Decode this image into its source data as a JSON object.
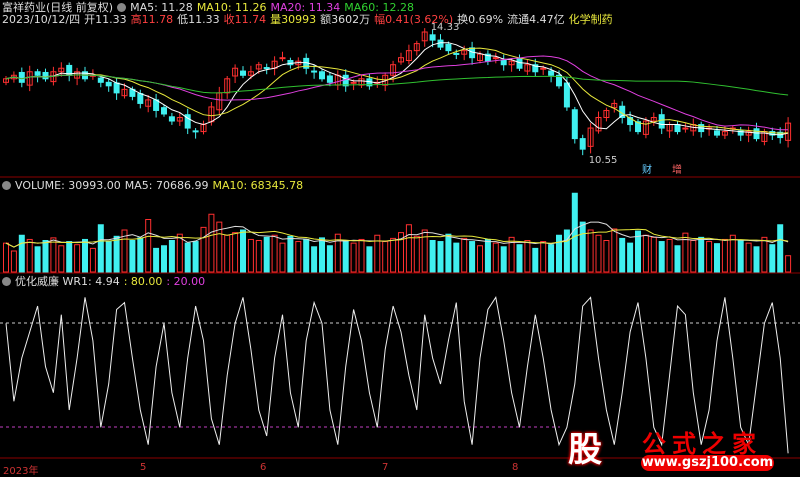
{
  "header": {
    "name": "富祥药业(日线 前复权)",
    "ma5": "MA5: 11.28",
    "ma10": "MA10: 11.26",
    "ma20": "MA20: 11.34",
    "ma60": "MA60: 12.28",
    "date": "2023/10/12/四",
    "open": "开11.33",
    "high": "高11.78",
    "low": "低11.33",
    "close": "收11.74",
    "vol": "量30993",
    "amount": "额3602万",
    "change": "幅0.41(3.62%)",
    "turnover": "换0.69%",
    "float": "流通4.47亿",
    "sector": "化学制药"
  },
  "annotations": {
    "max": "14.33",
    "min": "10.55",
    "tag1": "财",
    "tag2": "增"
  },
  "volume_header": {
    "label": "VOLUME: 30993.00",
    "ma5": "MA5: 70686.99",
    "ma10": "MA10: 68345.78"
  },
  "wr_header": {
    "label": "优化威廉 WR1: 4.94",
    "v80": ": 80.00",
    "v20": ": 20.00"
  },
  "dates": [
    "2023年",
    "5",
    "6",
    "7",
    "8"
  ],
  "logo": {
    "char": "股",
    "text": "公式之家",
    "url": "www.gszj100.com"
  },
  "colors": {
    "up": "#ff3030",
    "down": "#40f0f0",
    "ma5": "#ffffff",
    "ma10": "#e8e83c",
    "ma20": "#e040e0",
    "ma60": "#30c030"
  },
  "chart_data": {
    "type": "candlestick",
    "close": [
      13.0,
      13.1,
      12.9,
      13.2,
      13.1,
      13.0,
      13.2,
      13.3,
      13.1,
      13.2,
      13.0,
      13.1,
      12.9,
      12.8,
      12.6,
      12.7,
      12.5,
      12.3,
      12.4,
      12.1,
      12.0,
      11.8,
      11.9,
      11.6,
      11.5,
      11.7,
      12.2,
      12.6,
      13.0,
      13.3,
      13.1,
      13.2,
      13.4,
      13.3,
      13.5,
      13.6,
      13.4,
      13.5,
      13.3,
      13.2,
      13.0,
      12.9,
      13.1,
      12.8,
      12.9,
      13.0,
      12.8,
      12.9,
      13.1,
      13.4,
      13.6,
      13.8,
      14.0,
      14.33,
      14.1,
      13.9,
      13.8,
      13.7,
      13.8,
      13.6,
      13.7,
      13.5,
      13.6,
      13.4,
      13.5,
      13.3,
      13.4,
      13.2,
      13.3,
      13.1,
      12.8,
      12.2,
      11.3,
      11.0,
      11.6,
      11.9,
      12.1,
      12.3,
      11.9,
      11.7,
      11.5,
      11.8,
      11.9,
      11.6,
      11.7,
      11.5,
      11.6,
      11.7,
      11.5,
      11.6,
      11.4,
      11.5,
      11.6,
      11.4,
      11.5,
      11.3,
      11.5,
      11.4,
      11.33,
      11.74
    ],
    "volume": [
      55,
      40,
      70,
      62,
      48,
      60,
      65,
      50,
      58,
      52,
      62,
      45,
      90,
      58,
      68,
      80,
      60,
      65,
      100,
      45,
      50,
      60,
      72,
      55,
      58,
      85,
      110,
      95,
      70,
      75,
      80,
      62,
      60,
      66,
      70,
      55,
      68,
      58,
      62,
      48,
      65,
      50,
      72,
      60,
      55,
      62,
      48,
      70,
      58,
      64,
      75,
      90,
      68,
      80,
      60,
      58,
      72,
      55,
      64,
      58,
      50,
      62,
      55,
      48,
      66,
      52,
      60,
      45,
      58,
      52,
      70,
      80,
      150,
      95,
      80,
      70,
      60,
      82,
      64,
      55,
      78,
      70,
      66,
      58,
      62,
      50,
      74,
      60,
      66,
      58,
      54,
      62,
      70,
      60,
      55,
      48,
      66,
      52,
      90,
      31
    ],
    "wr": [
      80,
      35,
      60,
      75,
      90,
      55,
      40,
      85,
      30,
      60,
      95,
      70,
      20,
      45,
      88,
      92,
      60,
      30,
      10,
      55,
      80,
      40,
      20,
      60,
      90,
      70,
      25,
      10,
      50,
      80,
      95,
      65,
      30,
      15,
      60,
      85,
      40,
      20,
      70,
      92,
      80,
      30,
      10,
      55,
      88,
      70,
      40,
      20,
      65,
      90,
      75,
      50,
      30,
      85,
      60,
      45,
      70,
      92,
      35,
      10,
      60,
      88,
      95,
      70,
      40,
      20,
      55,
      85,
      60,
      30,
      10,
      20,
      45,
      90,
      95,
      60,
      30,
      10,
      40,
      75,
      92,
      60,
      20,
      10,
      50,
      90,
      85,
      40,
      10,
      30,
      70,
      95,
      60,
      20,
      10,
      45,
      80,
      92,
      60,
      5
    ]
  }
}
